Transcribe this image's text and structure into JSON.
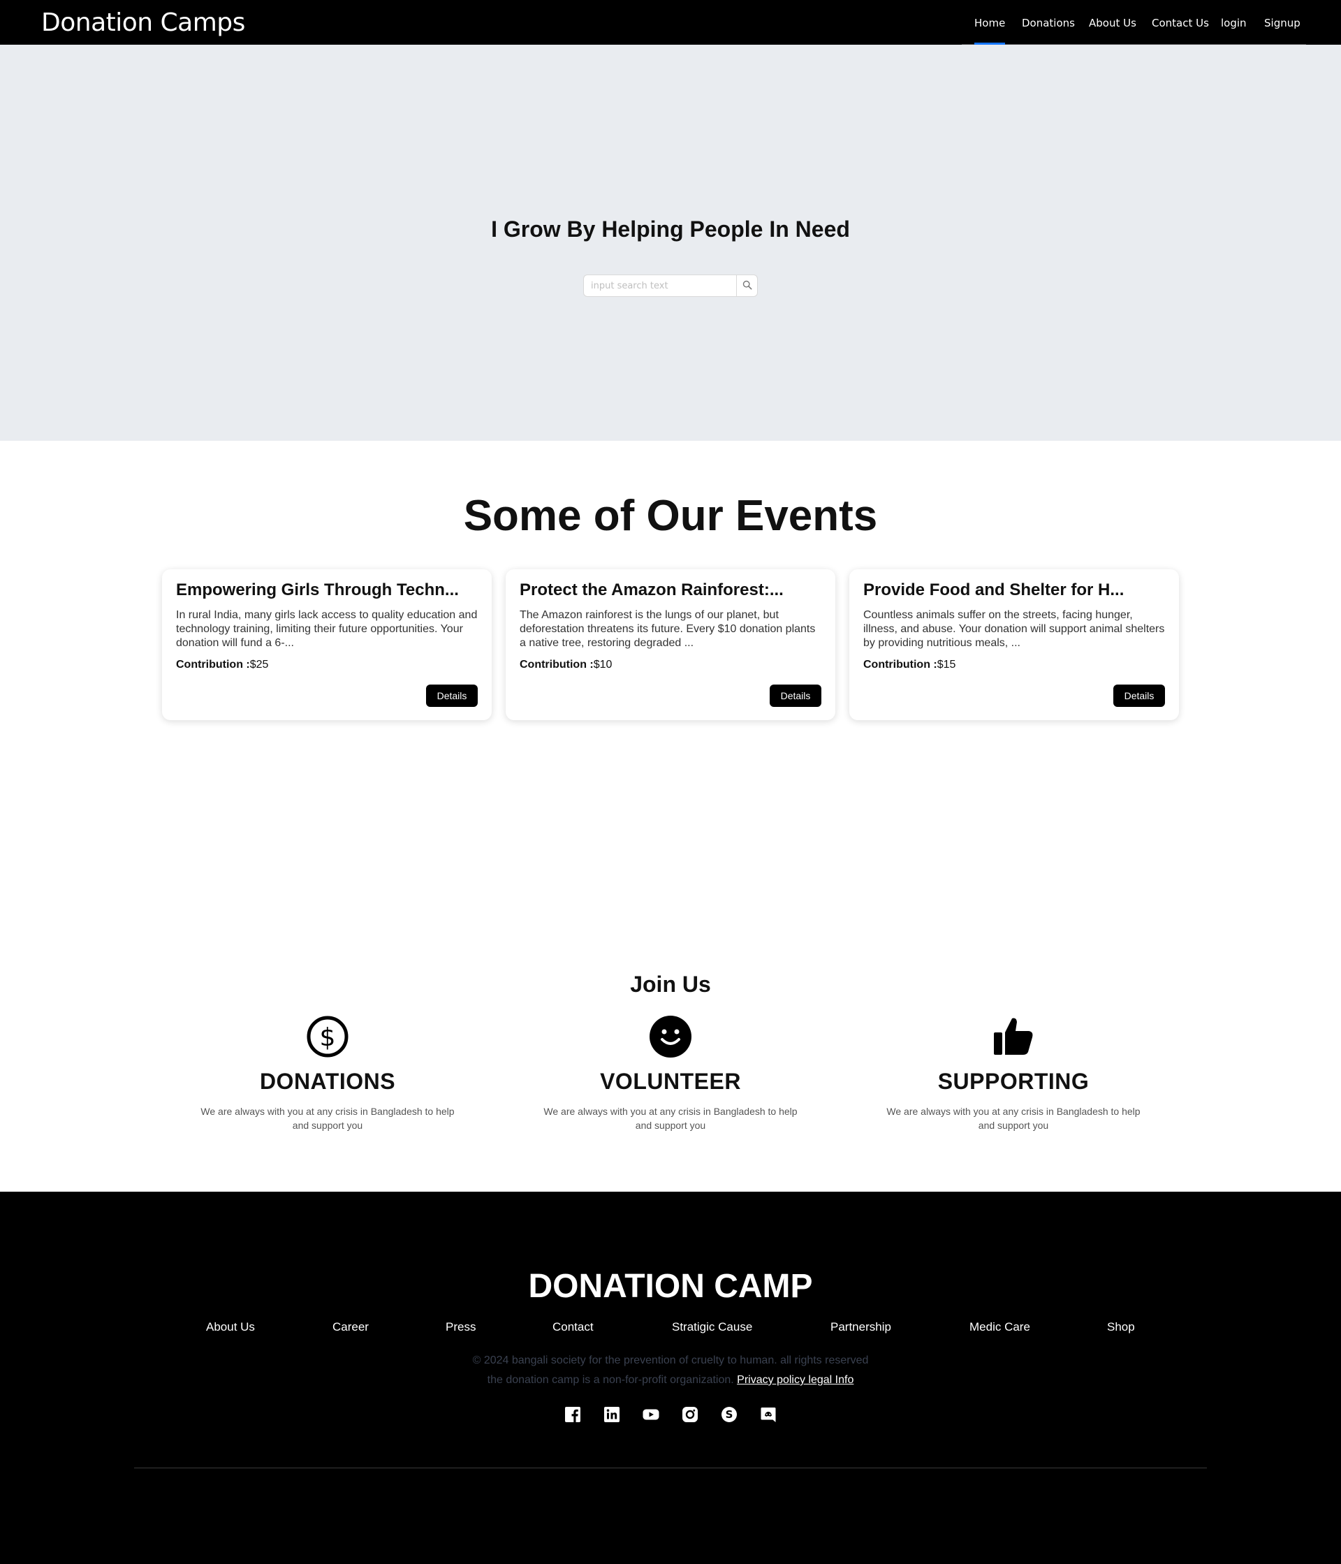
{
  "navbar": {
    "brand": "Donation Camps",
    "items": [
      "Home",
      "Donations",
      "About Us",
      "Contact Us",
      "login",
      "Signup"
    ],
    "active_item": "Home"
  },
  "hero": {
    "title": "I Grow By Helping People In Need",
    "search_placeholder": "input search text",
    "search_button_icon": "search-icon"
  },
  "events": {
    "title": "Some of Our Events",
    "cards": [
      {
        "title": "Empowering Girls Through Techn...",
        "description": "In rural India, many girls lack access to quality education and technology training, limiting their future opportunities. Your donation will fund a 6-...",
        "contribution_label": "Contribution :",
        "contribution_value": "$25",
        "button": "Details"
      },
      {
        "title": "Protect the Amazon Rainforest:...",
        "description": "The Amazon rainforest is the lungs of our planet, but deforestation threatens its future. Every $10 donation plants a native tree, restoring degraded ...",
        "contribution_label": "Contribution :",
        "contribution_value": "$10",
        "button": "Details"
      },
      {
        "title": "Provide Food and Shelter for H...",
        "description": "Countless animals suffer on the streets, facing hunger, illness, and abuse. Your donation will support animal shelters by providing nutritious meals, ...",
        "contribution_label": "Contribution :",
        "contribution_value": "$15",
        "button": "Details"
      }
    ]
  },
  "join": {
    "title": "Join Us",
    "columns": [
      {
        "icon": "dollar-circle-icon",
        "heading": "DONATIONS",
        "text": "We are always with you at any crisis in Bangladesh to help and support you"
      },
      {
        "icon": "smile-icon",
        "heading": "VOLUNTEER",
        "text": "We are always with you at any crisis in Bangladesh to help and support you"
      },
      {
        "icon": "thumbs-up-icon",
        "heading": "SUPPORTING",
        "text": "We are always with you at any crisis in Bangladesh to help and support you"
      }
    ]
  },
  "footer": {
    "title": "DONATION CAMP",
    "links": [
      "About Us",
      "Career",
      "Press",
      "Contact",
      "Stratigic Cause",
      "Partnership",
      "Medic Care",
      "Shop"
    ],
    "copyright_line1": "© 2024 bangali society for the prevention of cruelty to human. all rights reserved",
    "copyright_line2": "the donation camp is a non-for-profit organization.",
    "privacy_link": "Privacy policy legal Info",
    "social_icons": [
      "facebook-icon",
      "linkedin-icon",
      "youtube-icon",
      "instagram-icon",
      "skype-icon",
      "discord-icon"
    ]
  },
  "colors": {
    "navbar_bg": "#000000",
    "hero_bg": "#e9ecf0",
    "active_underline": "#1677ff",
    "footer_bg": "#000000",
    "footer_muted_text": "#3a4150"
  }
}
